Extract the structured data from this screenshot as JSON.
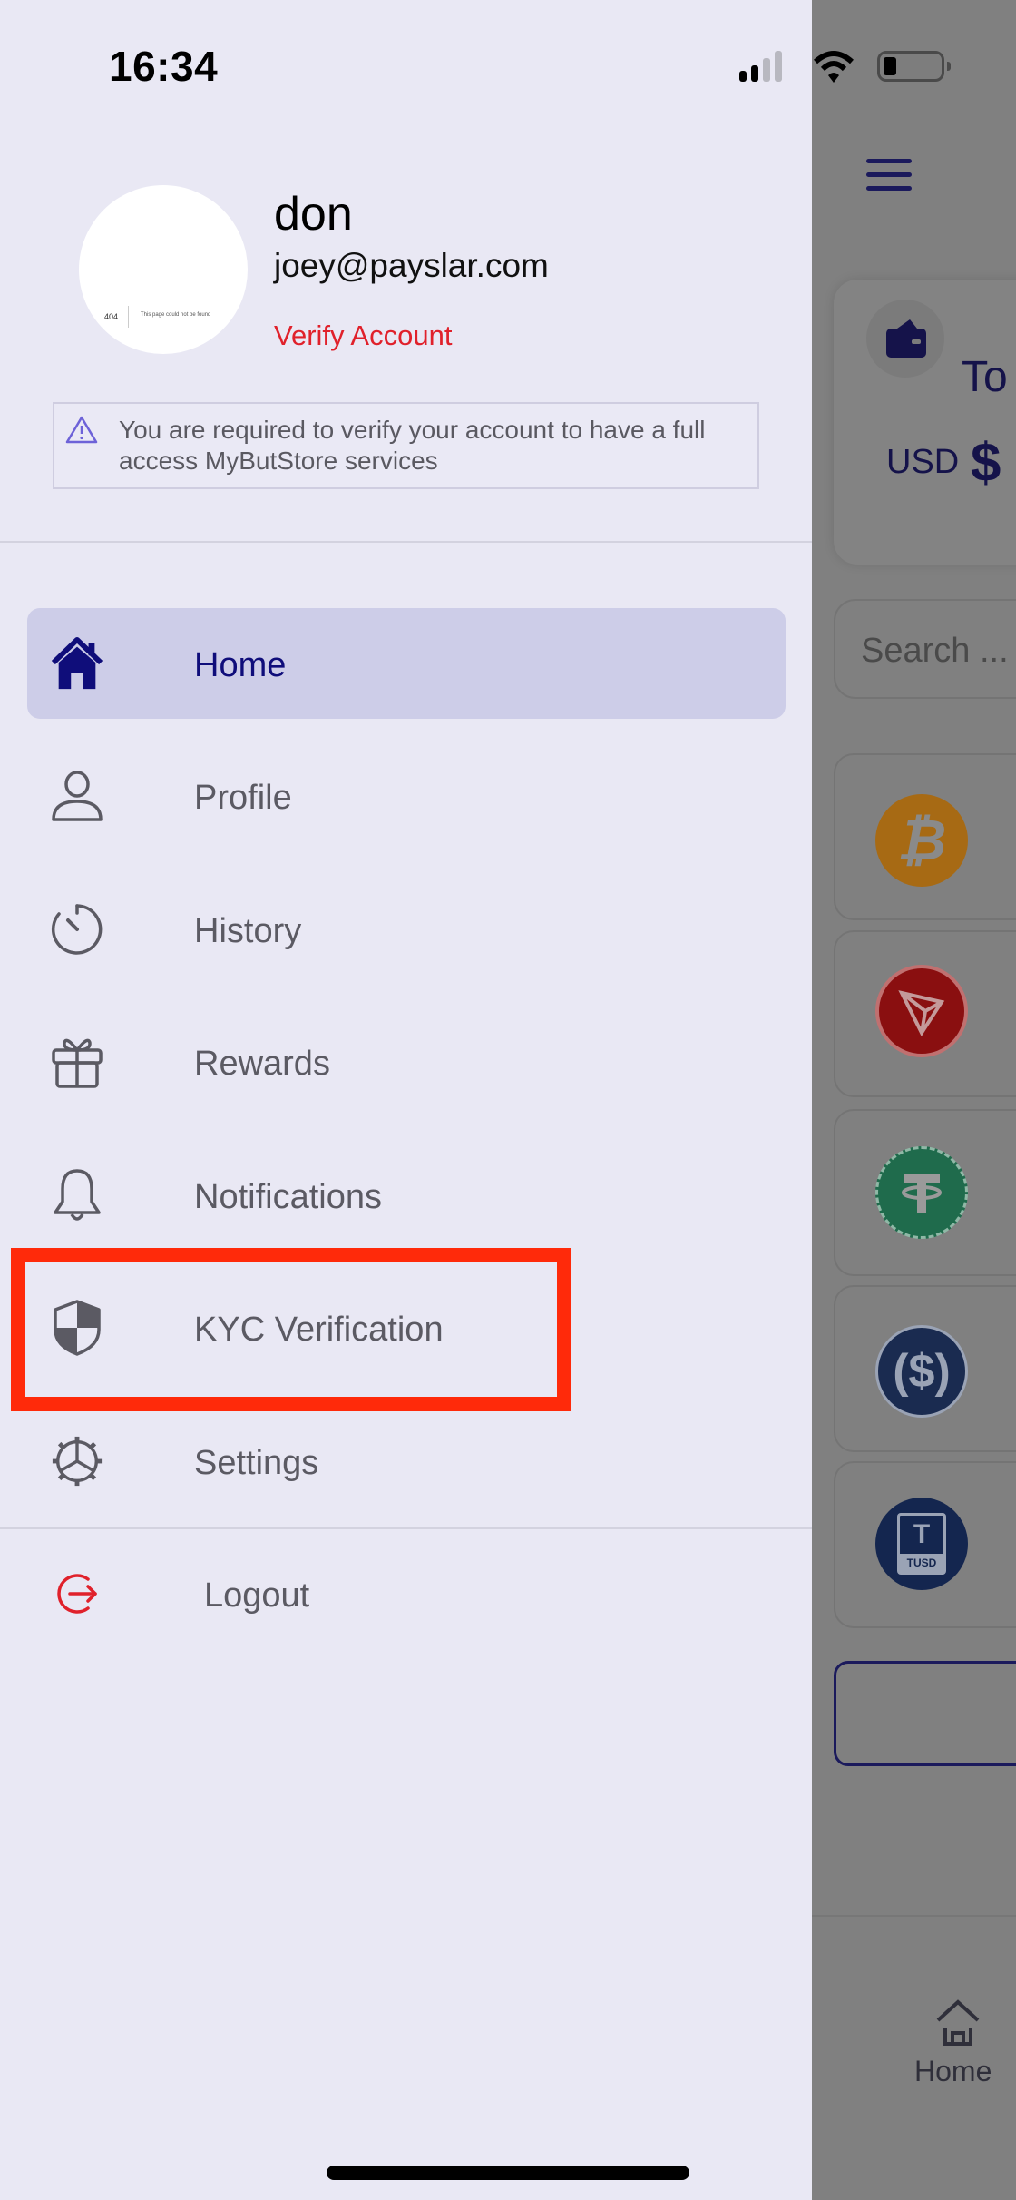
{
  "status_bar": {
    "time": "16:34",
    "icons": [
      "signal-icon",
      "wifi-icon",
      "battery-icon"
    ]
  },
  "profile": {
    "name": "don",
    "email": "joey@payslar.com",
    "verify_link": "Verify Account",
    "avatar_placeholder": {
      "code": "404",
      "message": "This page could not be found"
    }
  },
  "warning": {
    "icon": "warning-icon",
    "text": "You are required to verify your account to have a full access MyButStore services"
  },
  "menu": {
    "items": [
      {
        "label": "Home",
        "icon": "home-icon",
        "active": true
      },
      {
        "label": "Profile",
        "icon": "user-icon",
        "active": false
      },
      {
        "label": "History",
        "icon": "timer-icon",
        "active": false
      },
      {
        "label": "Rewards",
        "icon": "gift-icon",
        "active": false
      },
      {
        "label": "Notifications",
        "icon": "bell-icon",
        "active": false
      },
      {
        "label": "KYC Verification",
        "icon": "shield-icon",
        "active": false
      },
      {
        "label": "Settings",
        "icon": "gear-icon",
        "active": false
      }
    ],
    "logout": {
      "label": "Logout",
      "icon": "logout-icon"
    }
  },
  "annotation": {
    "highlighted_item": "KYC Verification",
    "color": "#ff2a0a"
  },
  "background_app": {
    "total_label": "To",
    "currency": "USD",
    "amount_prefix": "$",
    "search_placeholder": "Search ...",
    "coins": [
      "bitcoin",
      "tron",
      "tether",
      "usd-coin",
      "trueusd"
    ],
    "tusd_label": "TUSD",
    "bottom_nav": {
      "home_label": "Home"
    }
  },
  "colors": {
    "accent": "#0f0d7a",
    "danger": "#e0212b",
    "drawer_bg": "#e9e8f4",
    "active_bg": "#cdcde8"
  }
}
